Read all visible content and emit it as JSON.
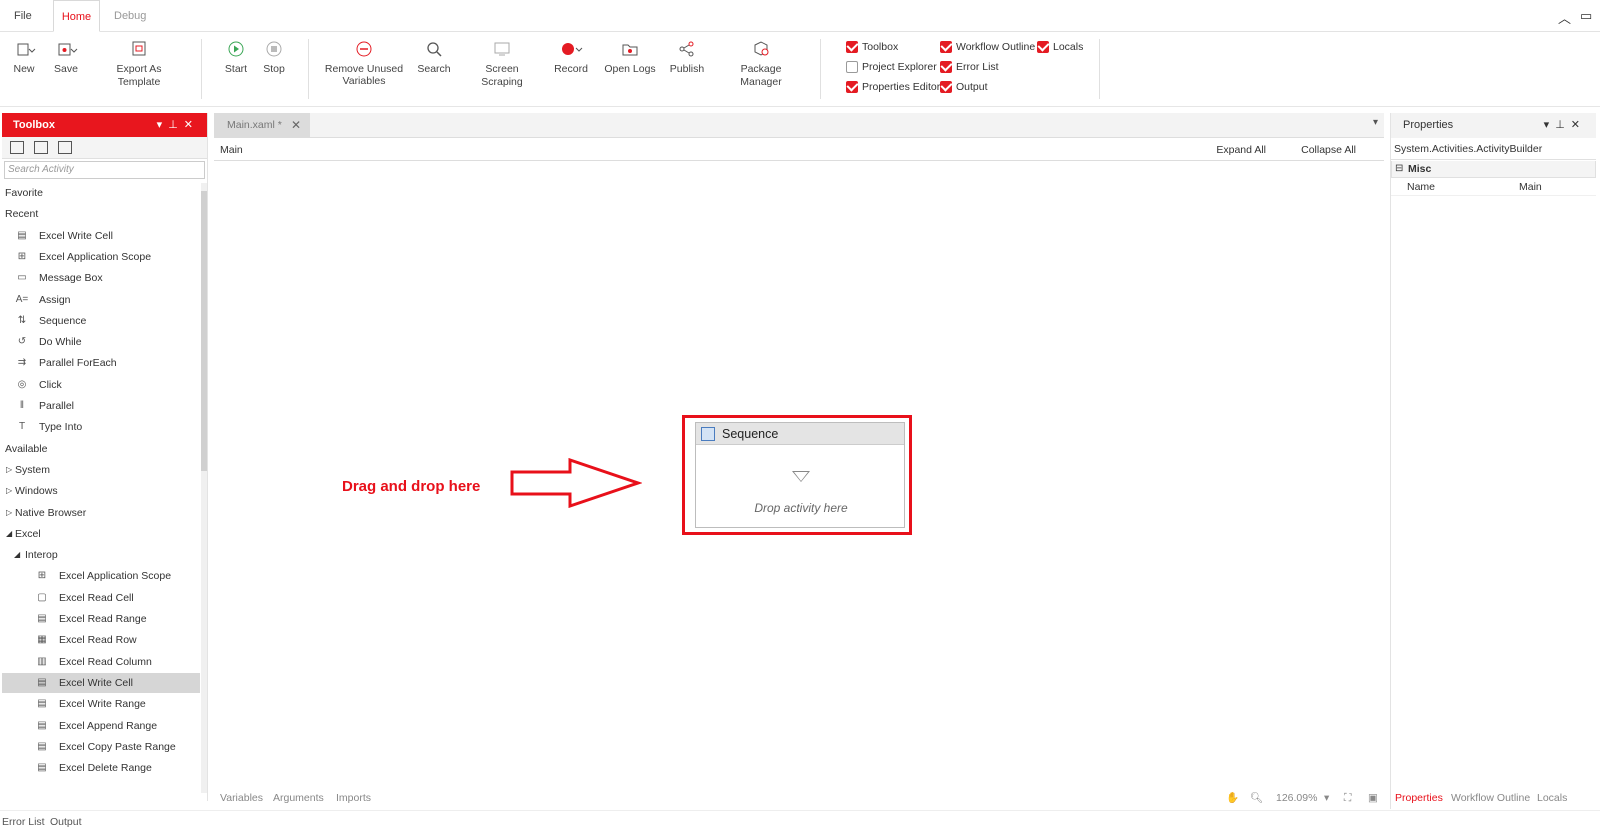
{
  "tabs": {
    "file": "File",
    "home": "Home",
    "debug": "Debug"
  },
  "ribbon": {
    "new": "New",
    "save": "Save",
    "export_template": "Export As Template",
    "start": "Start",
    "stop": "Stop",
    "remove_unused_1": "Remove Unused",
    "remove_unused_2": "Variables",
    "search": "Search",
    "screen_scraping": "Screen Scraping",
    "record": "Record",
    "open_logs": "Open Logs",
    "publish": "Publish",
    "package_manager": "Package Manager"
  },
  "panels": {
    "toolbox": {
      "label": "Toolbox",
      "checked": true
    },
    "project_explorer": {
      "label": "Project Explorer",
      "checked": false
    },
    "properties_editor": {
      "label": "Properties Editor",
      "checked": true
    },
    "workflow_outline": {
      "label": "Workflow Outline",
      "checked": true
    },
    "error_list": {
      "label": "Error List",
      "checked": true
    },
    "output": {
      "label": "Output",
      "checked": true
    },
    "locals": {
      "label": "Locals",
      "checked": true
    }
  },
  "toolbox": {
    "title": "Toolbox",
    "search_placeholder": "Search Activity",
    "items": [
      {
        "label": "Favorite",
        "kind": "section"
      },
      {
        "label": "Recent",
        "kind": "section"
      },
      {
        "label": "Excel Write Cell",
        "kind": "item",
        "icon": "excel-write-cell-icon"
      },
      {
        "label": "Excel Application Scope",
        "kind": "item",
        "icon": "excel-scope-icon"
      },
      {
        "label": "Message Box",
        "kind": "item",
        "icon": "message-box-icon"
      },
      {
        "label": "Assign",
        "kind": "item",
        "icon": "assign-icon"
      },
      {
        "label": "Sequence",
        "kind": "item",
        "icon": "sequence-icon"
      },
      {
        "label": "Do While",
        "kind": "item",
        "icon": "do-while-icon"
      },
      {
        "label": "Parallel ForEach",
        "kind": "item",
        "icon": "parallel-foreach-icon"
      },
      {
        "label": "Click",
        "kind": "item",
        "icon": "click-icon"
      },
      {
        "label": "Parallel",
        "kind": "item",
        "icon": "parallel-icon"
      },
      {
        "label": "Type Into",
        "kind": "item",
        "icon": "type-into-icon"
      },
      {
        "label": "Available",
        "kind": "section"
      },
      {
        "label": "System",
        "kind": "group",
        "expanded": false
      },
      {
        "label": "Windows",
        "kind": "group",
        "expanded": false
      },
      {
        "label": "Native Browser",
        "kind": "group",
        "expanded": false
      },
      {
        "label": "Excel",
        "kind": "group",
        "expanded": true
      },
      {
        "label": "Interop",
        "kind": "subgroup",
        "expanded": true
      },
      {
        "label": "Excel Application Scope",
        "kind": "subitem",
        "icon": "excel-scope-icon"
      },
      {
        "label": "Excel Read Cell",
        "kind": "subitem",
        "icon": "excel-read-cell-icon"
      },
      {
        "label": "Excel Read Range",
        "kind": "subitem",
        "icon": "excel-read-range-icon"
      },
      {
        "label": "Excel Read Row",
        "kind": "subitem",
        "icon": "excel-read-row-icon"
      },
      {
        "label": "Excel Read Column",
        "kind": "subitem",
        "icon": "excel-read-column-icon"
      },
      {
        "label": "Excel Write Cell",
        "kind": "subitem",
        "icon": "excel-write-cell-icon",
        "selected": true
      },
      {
        "label": "Excel Write Range",
        "kind": "subitem",
        "icon": "excel-write-range-icon"
      },
      {
        "label": "Excel Append Range",
        "kind": "subitem",
        "icon": "excel-append-range-icon"
      },
      {
        "label": "Excel Copy Paste Range",
        "kind": "subitem",
        "icon": "excel-copy-paste-icon"
      },
      {
        "label": "Excel Delete Range",
        "kind": "subitem",
        "icon": "excel-delete-range-icon"
      }
    ]
  },
  "document": {
    "tab_label": "Main.xaml *",
    "breadcrumb": "Main",
    "expand_all": "Expand All",
    "collapse_all": "Collapse All",
    "hint": "Drag and drop here",
    "sequence_title": "Sequence",
    "drop_text": "Drop activity here",
    "footer": {
      "variables": "Variables",
      "arguments": "Arguments",
      "imports": "Imports",
      "zoom": "126.09%"
    }
  },
  "properties": {
    "title": "Properties",
    "type": "System.Activities.ActivityBuilder",
    "category": "Misc",
    "rows": [
      {
        "key": "Name",
        "value": "Main"
      }
    ],
    "footer": {
      "properties": "Properties",
      "workflow_outline": "Workflow Outline",
      "locals": "Locals"
    }
  },
  "statusbar": {
    "error_list": "Error List",
    "output": "Output"
  },
  "colors": {
    "accent": "#e8101a"
  }
}
